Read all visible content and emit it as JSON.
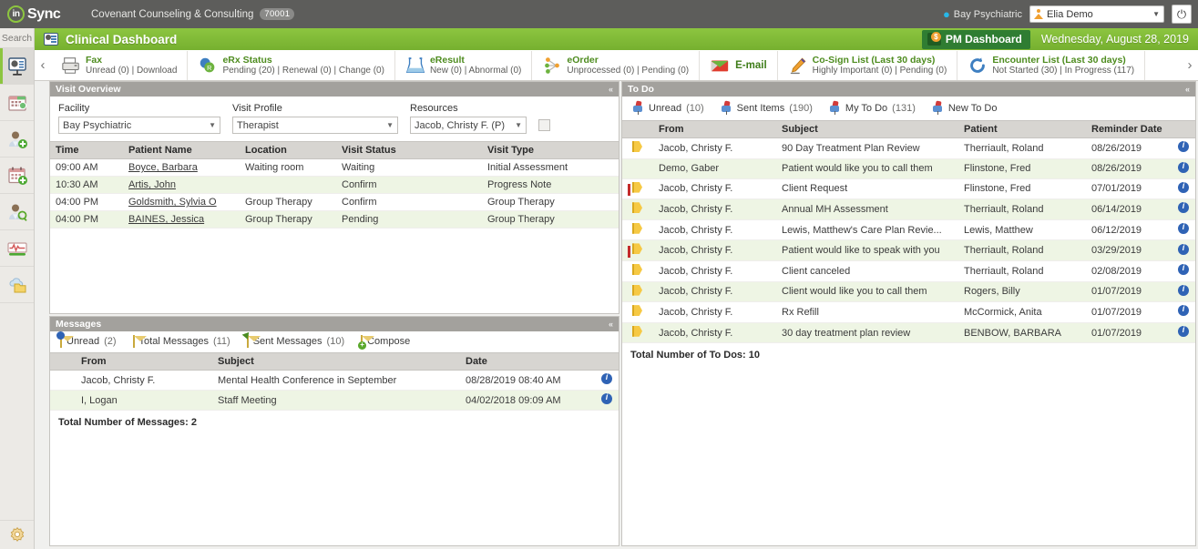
{
  "brand": {
    "logo_in": "in",
    "logo_sync": "Sync",
    "practice_name": "Covenant Counseling & Consulting",
    "practice_id": "70001",
    "facility_tag": "Bay Psychiatric",
    "user_name": "Elia Demo"
  },
  "titlebar": {
    "page_title": "Clinical Dashboard",
    "pm_dashboard": "PM Dashboard",
    "date": "Wednesday, August 28, 2019"
  },
  "sidebar": {
    "search_label": "Search",
    "items": [
      {
        "name": "clinical-dashboard",
        "icon": "dashboard-monitor-icon",
        "active": true
      },
      {
        "name": "scheduler",
        "icon": "calendar-clock-icon",
        "active": false
      },
      {
        "name": "add-patient",
        "icon": "patient-add-icon",
        "active": false
      },
      {
        "name": "add-appointment",
        "icon": "calendar-add-icon",
        "active": false
      },
      {
        "name": "patient-search",
        "icon": "patient-search-icon",
        "active": false
      },
      {
        "name": "vitals",
        "icon": "heartbeat-icon",
        "active": false
      },
      {
        "name": "documents",
        "icon": "cloud-folder-icon",
        "active": false
      }
    ],
    "bottom_item": {
      "name": "settings",
      "icon": "gear-icon"
    }
  },
  "toolbar": {
    "prev_label": "‹",
    "next_label": "›",
    "items": [
      {
        "icon": "fax-printer-icon",
        "title": "Fax",
        "sub": "Unread (0) | Download"
      },
      {
        "icon": "erx-pills-icon",
        "title": "eRx Status",
        "sub": "Pending (20) | Renewal (0) | Change (0)"
      },
      {
        "icon": "eresult-flask-icon",
        "title": "eResult",
        "sub": "New (0) | Abnormal (0)"
      },
      {
        "icon": "eorder-network-icon",
        "title": "eOrder",
        "sub": "Unprocessed (0) | Pending (0)"
      }
    ],
    "email": {
      "icon": "email-envelope-icon",
      "label": "E-mail"
    },
    "items_right": [
      {
        "icon": "cosign-pen-icon",
        "title": "Co-Sign List (Last 30 days)",
        "sub": "Highly Important (0) | Pending (0)"
      },
      {
        "icon": "encounter-refresh-icon",
        "title": "Encounter List (Last 30 days)",
        "sub": "Not Started (30) | In Progress (117)"
      }
    ]
  },
  "visit_overview": {
    "panel_title": "Visit Overview",
    "collapse": "«",
    "filters": [
      {
        "label": "Facility",
        "value": "Bay Psychiatric"
      },
      {
        "label": "Visit Profile",
        "value": "Therapist"
      },
      {
        "label": "Resources",
        "value": "Jacob, Christy F. (P)"
      }
    ],
    "columns": [
      "Time",
      "Patient Name",
      "Location",
      "Visit Status",
      "Visit Type"
    ],
    "rows": [
      {
        "time": "09:00 AM",
        "patient": "Boyce, Barbara",
        "location": "Waiting room",
        "status": "Waiting",
        "type": "Initial Assessment"
      },
      {
        "time": "10:30 AM",
        "patient": "Artis, John",
        "location": "",
        "status": "Confirm",
        "type": "Progress Note"
      },
      {
        "time": "04:00 PM",
        "patient": "Goldsmith, Sylvia O",
        "location": "Group Therapy",
        "status": "Confirm",
        "type": "Group Therapy"
      },
      {
        "time": "04:00 PM",
        "patient": "BAINES, Jessica",
        "location": "Group Therapy",
        "status": "Pending",
        "type": "Group Therapy"
      }
    ]
  },
  "messages": {
    "panel_title": "Messages",
    "collapse": "«",
    "actions": [
      {
        "icon": "envelope-unread-icon",
        "label": "Unread",
        "count": "(2)"
      },
      {
        "icon": "envelope-icon",
        "label": "Total Messages",
        "count": "(11)"
      },
      {
        "icon": "envelope-sent-icon",
        "label": "Sent Messages",
        "count": "(10)"
      },
      {
        "icon": "envelope-compose-icon",
        "label": "Compose",
        "count": ""
      }
    ],
    "columns": [
      "From",
      "Subject",
      "Date"
    ],
    "rows": [
      {
        "from": "Jacob, Christy F.",
        "subject": "Mental Health Conference in September",
        "date": "08/28/2019 08:40 AM"
      },
      {
        "from": "I, Logan",
        "subject": "Staff Meeting",
        "date": "04/02/2018 09:09 AM"
      }
    ],
    "total": "Total Number of Messages: 2"
  },
  "todo": {
    "panel_title": "To Do",
    "collapse": "«",
    "actions": [
      {
        "icon": "pushpin-icon",
        "label": "Unread",
        "count": "(10)"
      },
      {
        "icon": "pushpin-icon",
        "label": "Sent Items",
        "count": "(190)"
      },
      {
        "icon": "pushpin-icon",
        "label": "My To Do",
        "count": "(131)"
      },
      {
        "icon": "pushpin-icon",
        "label": "New To Do",
        "count": ""
      }
    ],
    "columns": [
      "From",
      "Subject",
      "Patient",
      "Reminder Date"
    ],
    "rows": [
      {
        "priority": false,
        "from": "Jacob, Christy F.",
        "subject": "90 Day Treatment Plan Review",
        "patient": "Therriault, Roland",
        "date": "08/26/2019"
      },
      {
        "priority": false,
        "flag": false,
        "from": "Demo, Gaber",
        "subject": "Patient would like you to call them",
        "patient": "Flinstone, Fred",
        "date": "08/26/2019"
      },
      {
        "priority": true,
        "from": "Jacob, Christy F.",
        "subject": "Client Request",
        "patient": "Flinstone, Fred",
        "date": "07/01/2019"
      },
      {
        "priority": false,
        "from": "Jacob, Christy F.",
        "subject": "Annual MH Assessment",
        "patient": "Therriault, Roland",
        "date": "06/14/2019"
      },
      {
        "priority": false,
        "from": "Jacob, Christy F.",
        "subject": "Lewis, Matthew's Care Plan Revie...",
        "patient": "Lewis, Matthew",
        "date": "06/12/2019"
      },
      {
        "priority": true,
        "from": "Jacob, Christy F.",
        "subject": "Patient would like to speak with you",
        "patient": "Therriault, Roland",
        "date": "03/29/2019"
      },
      {
        "priority": false,
        "from": "Jacob, Christy F.",
        "subject": "Client canceled",
        "patient": "Therriault, Roland",
        "date": "02/08/2019"
      },
      {
        "priority": false,
        "from": "Jacob, Christy F.",
        "subject": "Client would like you to call them",
        "patient": "Rogers, Billy",
        "date": "01/07/2019"
      },
      {
        "priority": false,
        "from": "Jacob, Christy F.",
        "subject": "Rx Refill",
        "patient": "McCormick, Anita",
        "date": "01/07/2019"
      },
      {
        "priority": false,
        "from": "Jacob, Christy F.",
        "subject": "30 day treatment plan review",
        "patient": "BENBOW, BARBARA",
        "date": "01/07/2019"
      }
    ],
    "total": "Total Number of To Dos: 10"
  },
  "colors": {
    "brand_gray": "#5d5d5b",
    "accent_green": "#8cc540",
    "panel_header": "#a3a19d",
    "row_alt": "#eef5e4",
    "link_green": "#4e8c1f",
    "info_blue": "#2f63b5",
    "flag_yellow": "#f6c944",
    "priority_red": "#c42b2b"
  }
}
